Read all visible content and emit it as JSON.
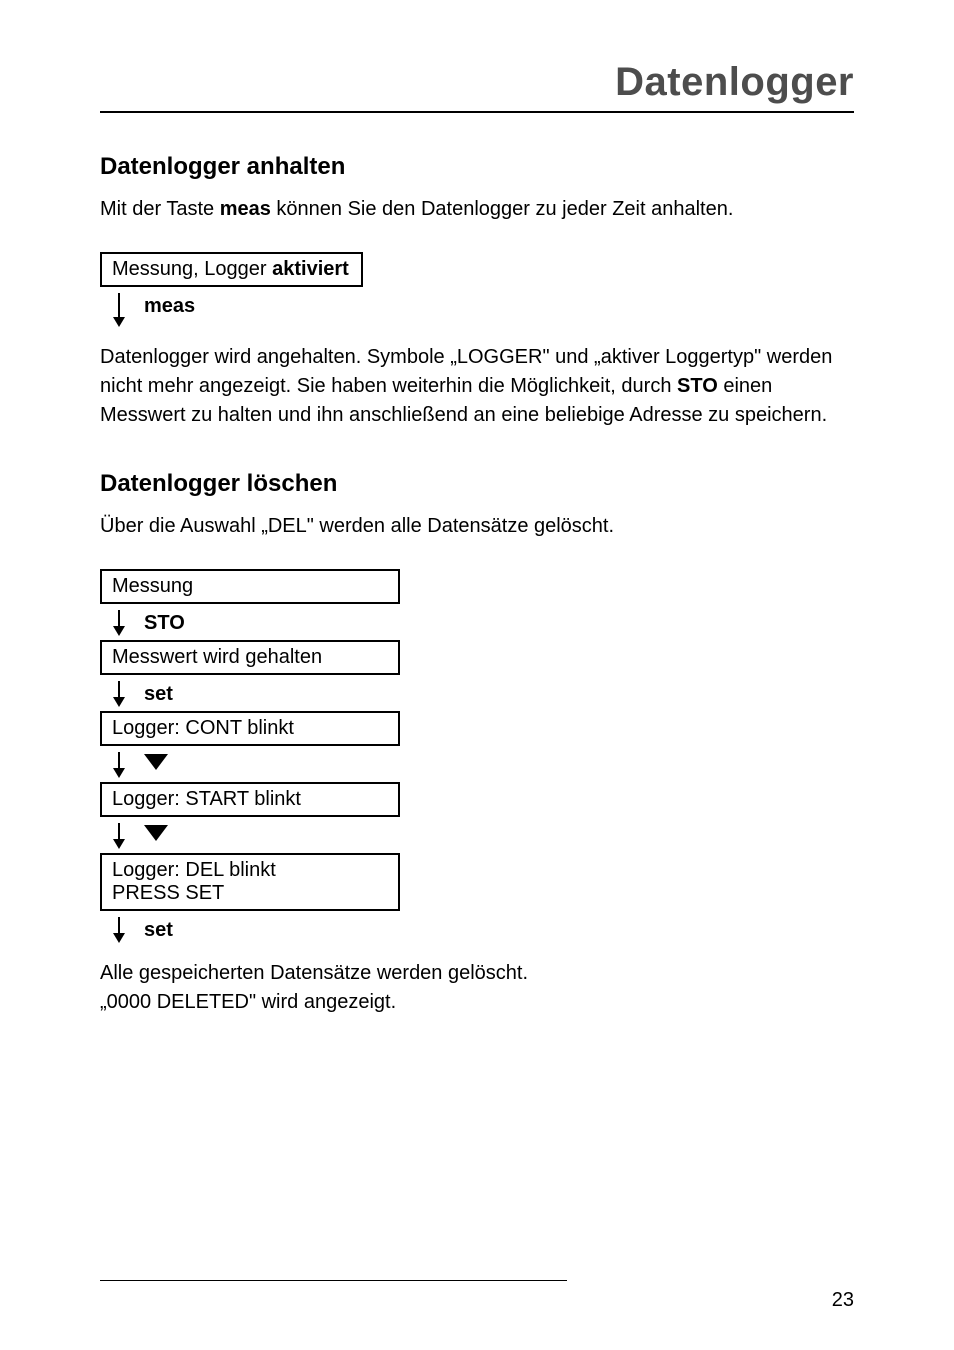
{
  "page_title": "Datenlogger",
  "section1": {
    "heading": "Datenlogger anhalten",
    "intro_parts": [
      "Mit der Taste ",
      "meas",
      " können Sie den Datenlogger zu jeder Zeit anhalten."
    ],
    "state_box_parts": [
      "Messung, Logger ",
      "aktiviert"
    ],
    "step_label": "meas",
    "explain_parts": [
      "Datenlogger wird angehalten. Symbole „LOGGER\" und „aktiver Loggertyp\" werden nicht mehr angezeigt. Sie haben weiterhin die Möglichkeit, durch ",
      "STO",
      " einen Messwert zu halten und ihn anschließend an eine beliebige Adresse zu speichern."
    ]
  },
  "section2": {
    "heading": "Datenlogger löschen",
    "intro": "Über die Auswahl „DEL\" werden alle Datensätze gelöscht.",
    "flow": {
      "box1": "Messung",
      "step1_label": "STO",
      "box2": "Messwert wird gehalten",
      "step2_label": "set",
      "box3": "Logger: CONT blinkt",
      "box4": "Logger: START blinkt",
      "box5_line1": "Logger: DEL blinkt",
      "box5_line2": "PRESS SET",
      "step5_label": "set"
    },
    "result_line1": "Alle gespeicherten Datensätze werden gelöscht.",
    "result_line2": "„0000 DELETED\" wird angezeigt."
  },
  "page_number": "23"
}
